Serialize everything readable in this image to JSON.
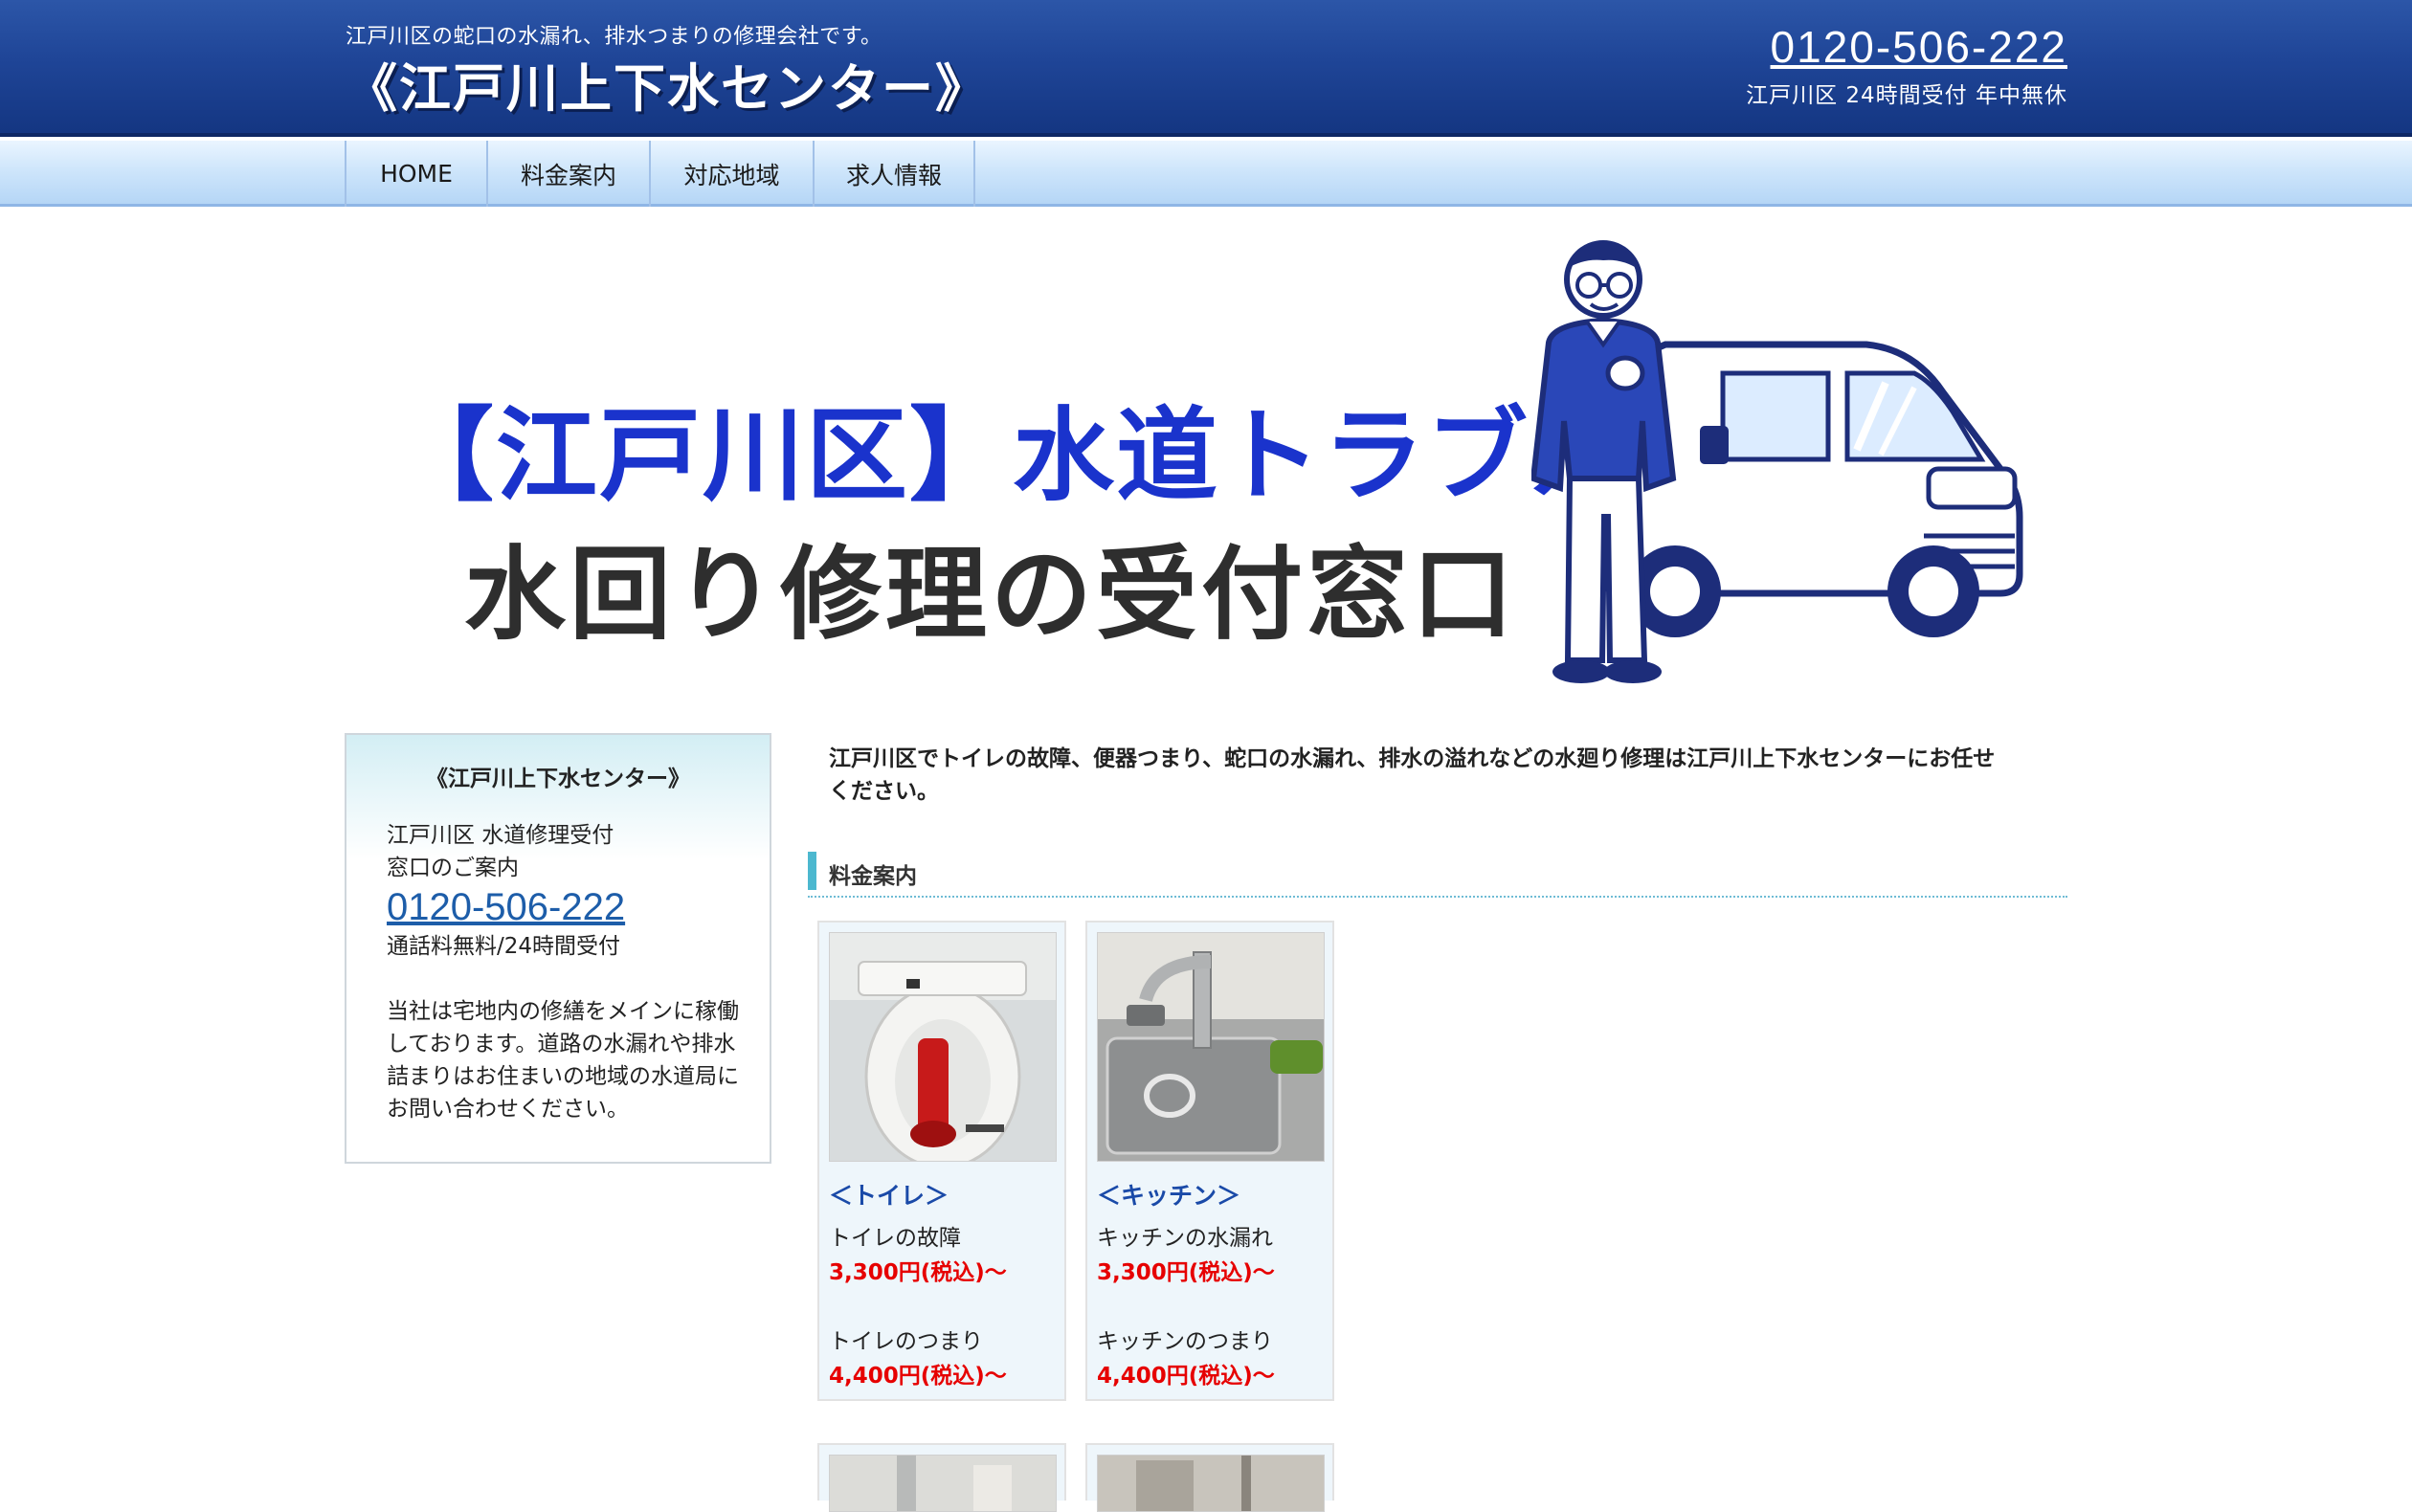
{
  "header": {
    "tagline": "江戸川区の蛇口の水漏れ、排水つまりの修理会社です。",
    "site_name": "《江戸川上下水センター》",
    "phone": "0120-506-222",
    "phone_sub": "江戸川区 24時間受付 年中無休"
  },
  "nav": {
    "items": [
      {
        "label": "HOME"
      },
      {
        "label": "料金案内"
      },
      {
        "label": "対応地域"
      },
      {
        "label": "求人情報"
      }
    ]
  },
  "hero": {
    "line1": "【江戸川区】水道トラブル",
    "line2": "水回り修理の受付窓口"
  },
  "sidebar": {
    "title": "《江戸川上下水センター》",
    "line1": "江戸川区 水道修理受付",
    "line2": "窓口のご案内",
    "phone": "0120-506-222",
    "line3": "通話料無料/24時間受付",
    "note": "当社は宅地内の修繕をメインに稼働しております。道路の水漏れや排水詰まりはお住まいの地域の水道局にお問い合わせください。"
  },
  "main": {
    "intro": "江戸川区でトイレの故障、便器つまり、蛇口の水漏れ、排水の溢れなどの水廻り修理は江戸川上下水センターにお任せください。",
    "section_title": "料金案内",
    "cards": [
      {
        "category": "＜トイレ＞",
        "item1": "トイレの故障",
        "price1": "3,300円(税込)〜",
        "item2": "トイレのつまり",
        "price2": "4,400円(税込)〜"
      },
      {
        "category": "＜キッチン＞",
        "item1": "キッチンの水漏れ",
        "price1": "3,300円(税込)〜",
        "item2": "キッチンのつまり",
        "price2": "4,400円(税込)〜"
      }
    ]
  },
  "colors": {
    "header_blue": "#1f4597",
    "nav_light_blue": "#cfe6fb",
    "hero_blue_text": "#1a33cc",
    "price_red": "#e60000",
    "link_blue": "#1d5da9",
    "accent_teal": "#4cb8cf"
  }
}
